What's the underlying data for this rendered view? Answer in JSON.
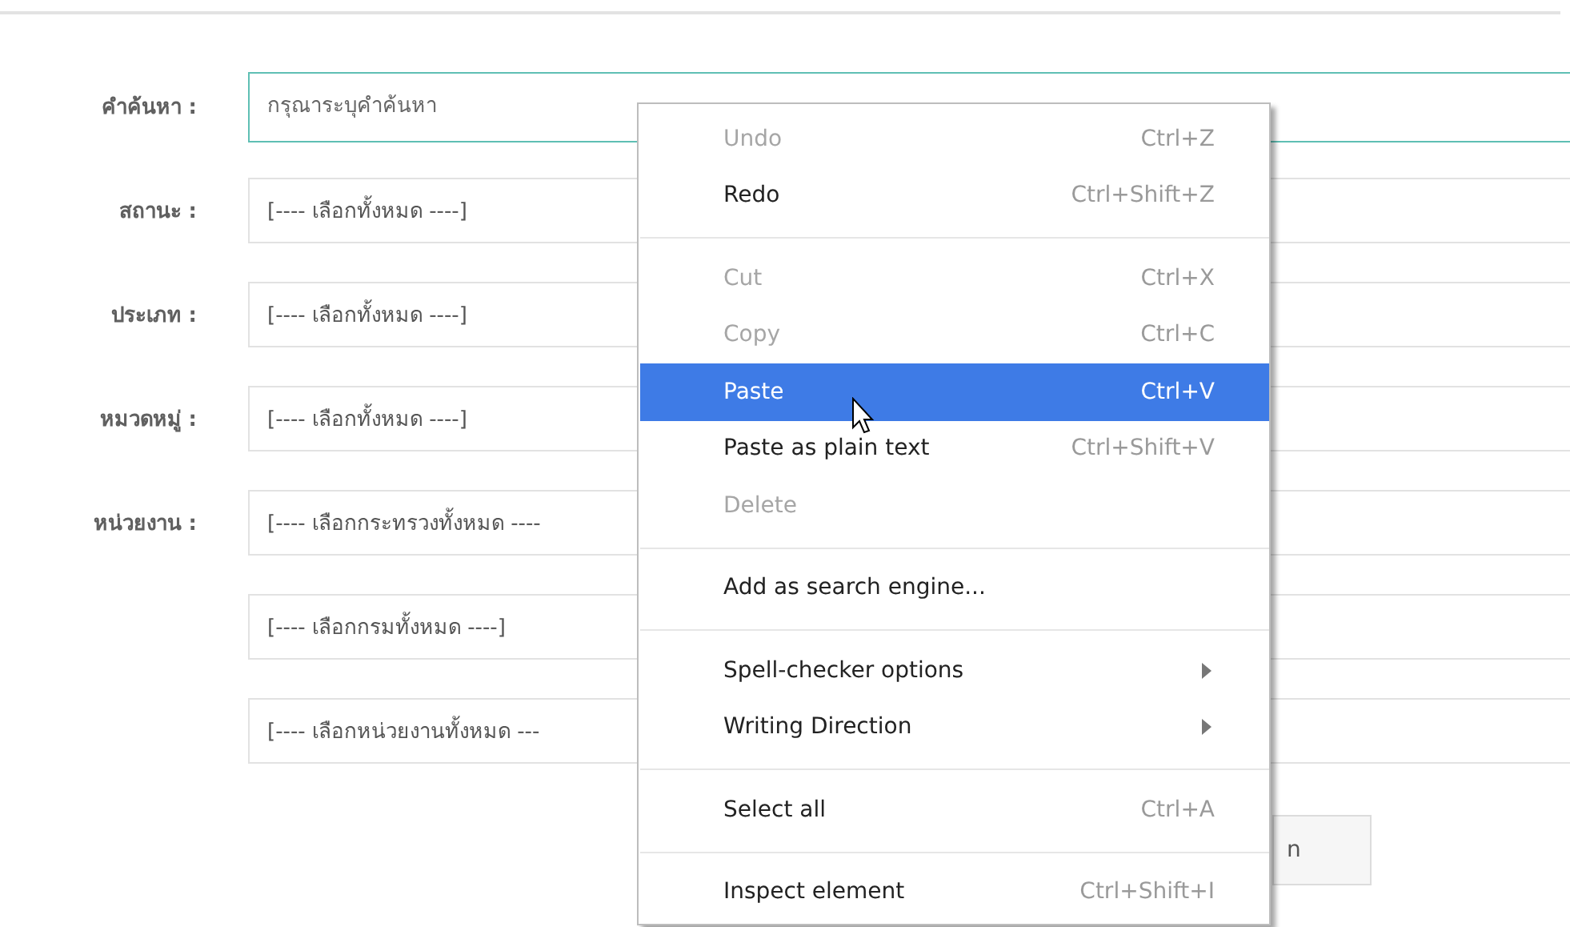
{
  "search": {
    "label": "คำค้นหา :",
    "placeholder": "กรุณาระบุคำค้นหา",
    "focused": true
  },
  "filters": [
    {
      "label": "สถานะ :",
      "value": "[---- เลือกทั้งหมด ----]"
    },
    {
      "label": "ประเภท :",
      "value": "[---- เลือกทั้งหมด ----]"
    },
    {
      "label": "หมวดหมู่ :",
      "value": "[---- เลือกทั้งหมด ----]"
    }
  ],
  "agency": {
    "label": "หน่วยงาน :",
    "fields": [
      "[---- เลือกกระทรวงทั้งหมด ----",
      "[---- เลือกกรมทั้งหมด ----]",
      "[---- เลือกหน่วยงานทั้งหมด ---"
    ]
  },
  "search_button": {
    "label": "n"
  },
  "context_menu": {
    "items": [
      {
        "kind": "item",
        "label": "Undo",
        "shortcut": "Ctrl+Z",
        "disabled": true,
        "selected": false
      },
      {
        "kind": "item",
        "label": "Redo",
        "shortcut": "Ctrl+Shift+Z",
        "disabled": false,
        "selected": false
      },
      {
        "kind": "separator"
      },
      {
        "kind": "item",
        "label": "Cut",
        "shortcut": "Ctrl+X",
        "disabled": true,
        "selected": false
      },
      {
        "kind": "item",
        "label": "Copy",
        "shortcut": "Ctrl+C",
        "disabled": true,
        "selected": false
      },
      {
        "kind": "item",
        "label": "Paste",
        "shortcut": "Ctrl+V",
        "disabled": false,
        "selected": true
      },
      {
        "kind": "item",
        "label": "Paste as plain text",
        "shortcut": "Ctrl+Shift+V",
        "disabled": false,
        "selected": false
      },
      {
        "kind": "item",
        "label": "Delete",
        "disabled": true,
        "selected": false
      },
      {
        "kind": "separator"
      },
      {
        "kind": "item",
        "label": "Add as search engine...",
        "disabled": false,
        "selected": false
      },
      {
        "kind": "separator"
      },
      {
        "kind": "submenu",
        "label": "Spell-checker options",
        "disabled": false,
        "selected": false
      },
      {
        "kind": "submenu",
        "label": "Writing Direction",
        "disabled": false,
        "selected": false
      },
      {
        "kind": "separator"
      },
      {
        "kind": "item",
        "label": "Select all",
        "shortcut": "Ctrl+A",
        "disabled": false,
        "selected": false
      },
      {
        "kind": "separator"
      },
      {
        "kind": "item",
        "label": "Inspect element",
        "shortcut": "Ctrl+Shift+I",
        "disabled": false,
        "selected": false
      }
    ]
  }
}
